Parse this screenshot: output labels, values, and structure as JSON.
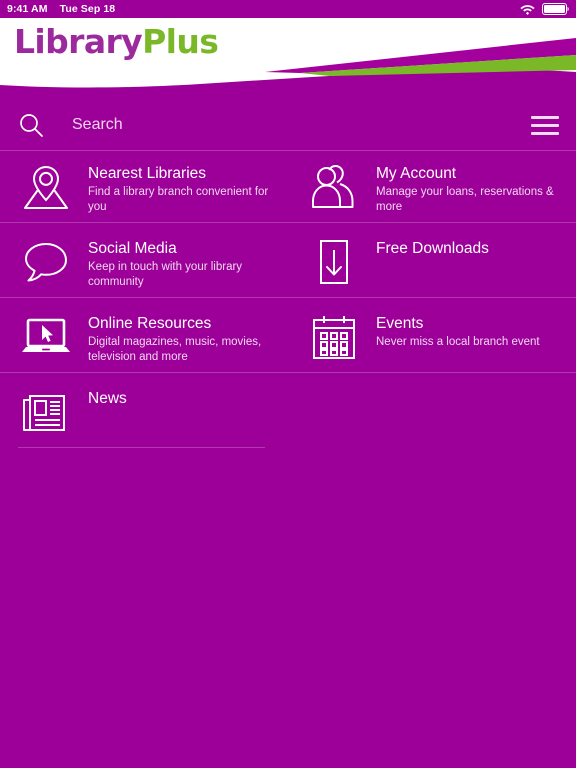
{
  "status_bar": {
    "time": "9:41 AM",
    "date": "Tue Sep 18",
    "wifi_icon": "wifi-icon",
    "battery_icon": "battery-icon"
  },
  "brand": {
    "name_part_1": "Library",
    "name_part_2": "Plus",
    "purple": "#9c2a9c",
    "green": "#7ab828",
    "background_purple": "#9d0099"
  },
  "search": {
    "placeholder": "Search",
    "value": "",
    "search_icon": "search-icon",
    "menu_icon": "hamburger-menu-icon"
  },
  "tiles": [
    {
      "id": "nearest-libraries",
      "title": "Nearest Libraries",
      "subtitle": "Find a library branch convenient for you",
      "icon": "map-pin-icon"
    },
    {
      "id": "my-account",
      "title": "My Account",
      "subtitle": "Manage your loans, reservations & more",
      "icon": "users-icon"
    },
    {
      "id": "social-media",
      "title": "Social Media",
      "subtitle": "Keep in touch with your library community",
      "icon": "speech-bubble-icon"
    },
    {
      "id": "free-downloads",
      "title": "Free Downloads",
      "subtitle": "",
      "icon": "download-icon"
    },
    {
      "id": "online-resources",
      "title": "Online Resources",
      "subtitle": "Digital magazines, music, movies, television and more",
      "icon": "laptop-cursor-icon"
    },
    {
      "id": "events",
      "title": "Events",
      "subtitle": "Never miss a local branch event",
      "icon": "calendar-icon"
    },
    {
      "id": "news",
      "title": "News",
      "subtitle": "",
      "icon": "newspaper-icon"
    }
  ]
}
